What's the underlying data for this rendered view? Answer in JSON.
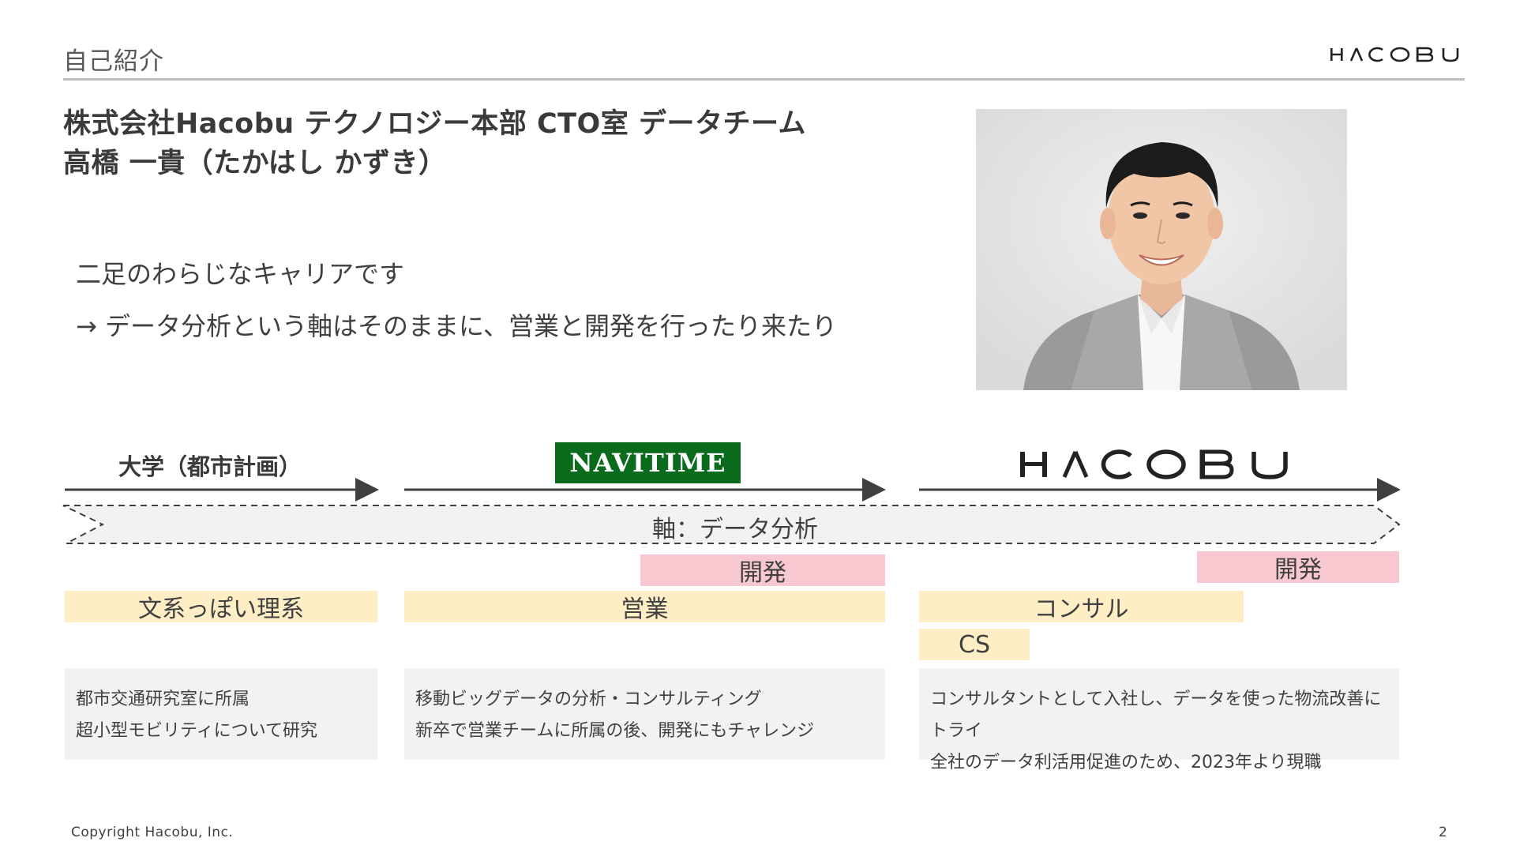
{
  "header": {
    "title": "自己紹介",
    "logo_text": "HACOBU"
  },
  "profile": {
    "affiliation": "株式会社Hacobu テクノロジー本部 CTO室 データチーム",
    "name": "高橋 一貴（たかはし かずき）",
    "career_line1": "二足のわらじなキャリアです",
    "career_line2": "→ データ分析という軸はそのままに、営業と開発を行ったり来たり"
  },
  "timeline": {
    "stages": {
      "university": "大学（都市計画）",
      "navitime": "NAVITIME",
      "hacobu": "HACOBU"
    },
    "axis_label": "軸：データ分析",
    "bars": {
      "univ_role": "文系っぽい理系",
      "navitime_dev": "開発",
      "navitime_sales": "営業",
      "hacobu_dev": "開発",
      "hacobu_consult": "コンサル",
      "hacobu_cs": "CS"
    },
    "descriptions": {
      "university": [
        "都市交通研究室に所属",
        "超小型モビリティについて研究"
      ],
      "navitime": [
        "移動ビッグデータの分析・コンサルティング",
        "新卒で営業チームに所属の後、開発にもチャレンジ"
      ],
      "hacobu": [
        "コンサルタントとして入社し、データを使った物流改善にトライ",
        "全社のデータ利活用促進のため、2023年より現職"
      ]
    }
  },
  "footer": {
    "copyright": "Copyright Hacobu, Inc.",
    "page": "2"
  },
  "colors": {
    "pink_bar": "#f8c8d0",
    "cream_bar": "#fdeec5",
    "navitime_green": "#0b6b1d",
    "desc_bg": "#f2f2f2"
  }
}
